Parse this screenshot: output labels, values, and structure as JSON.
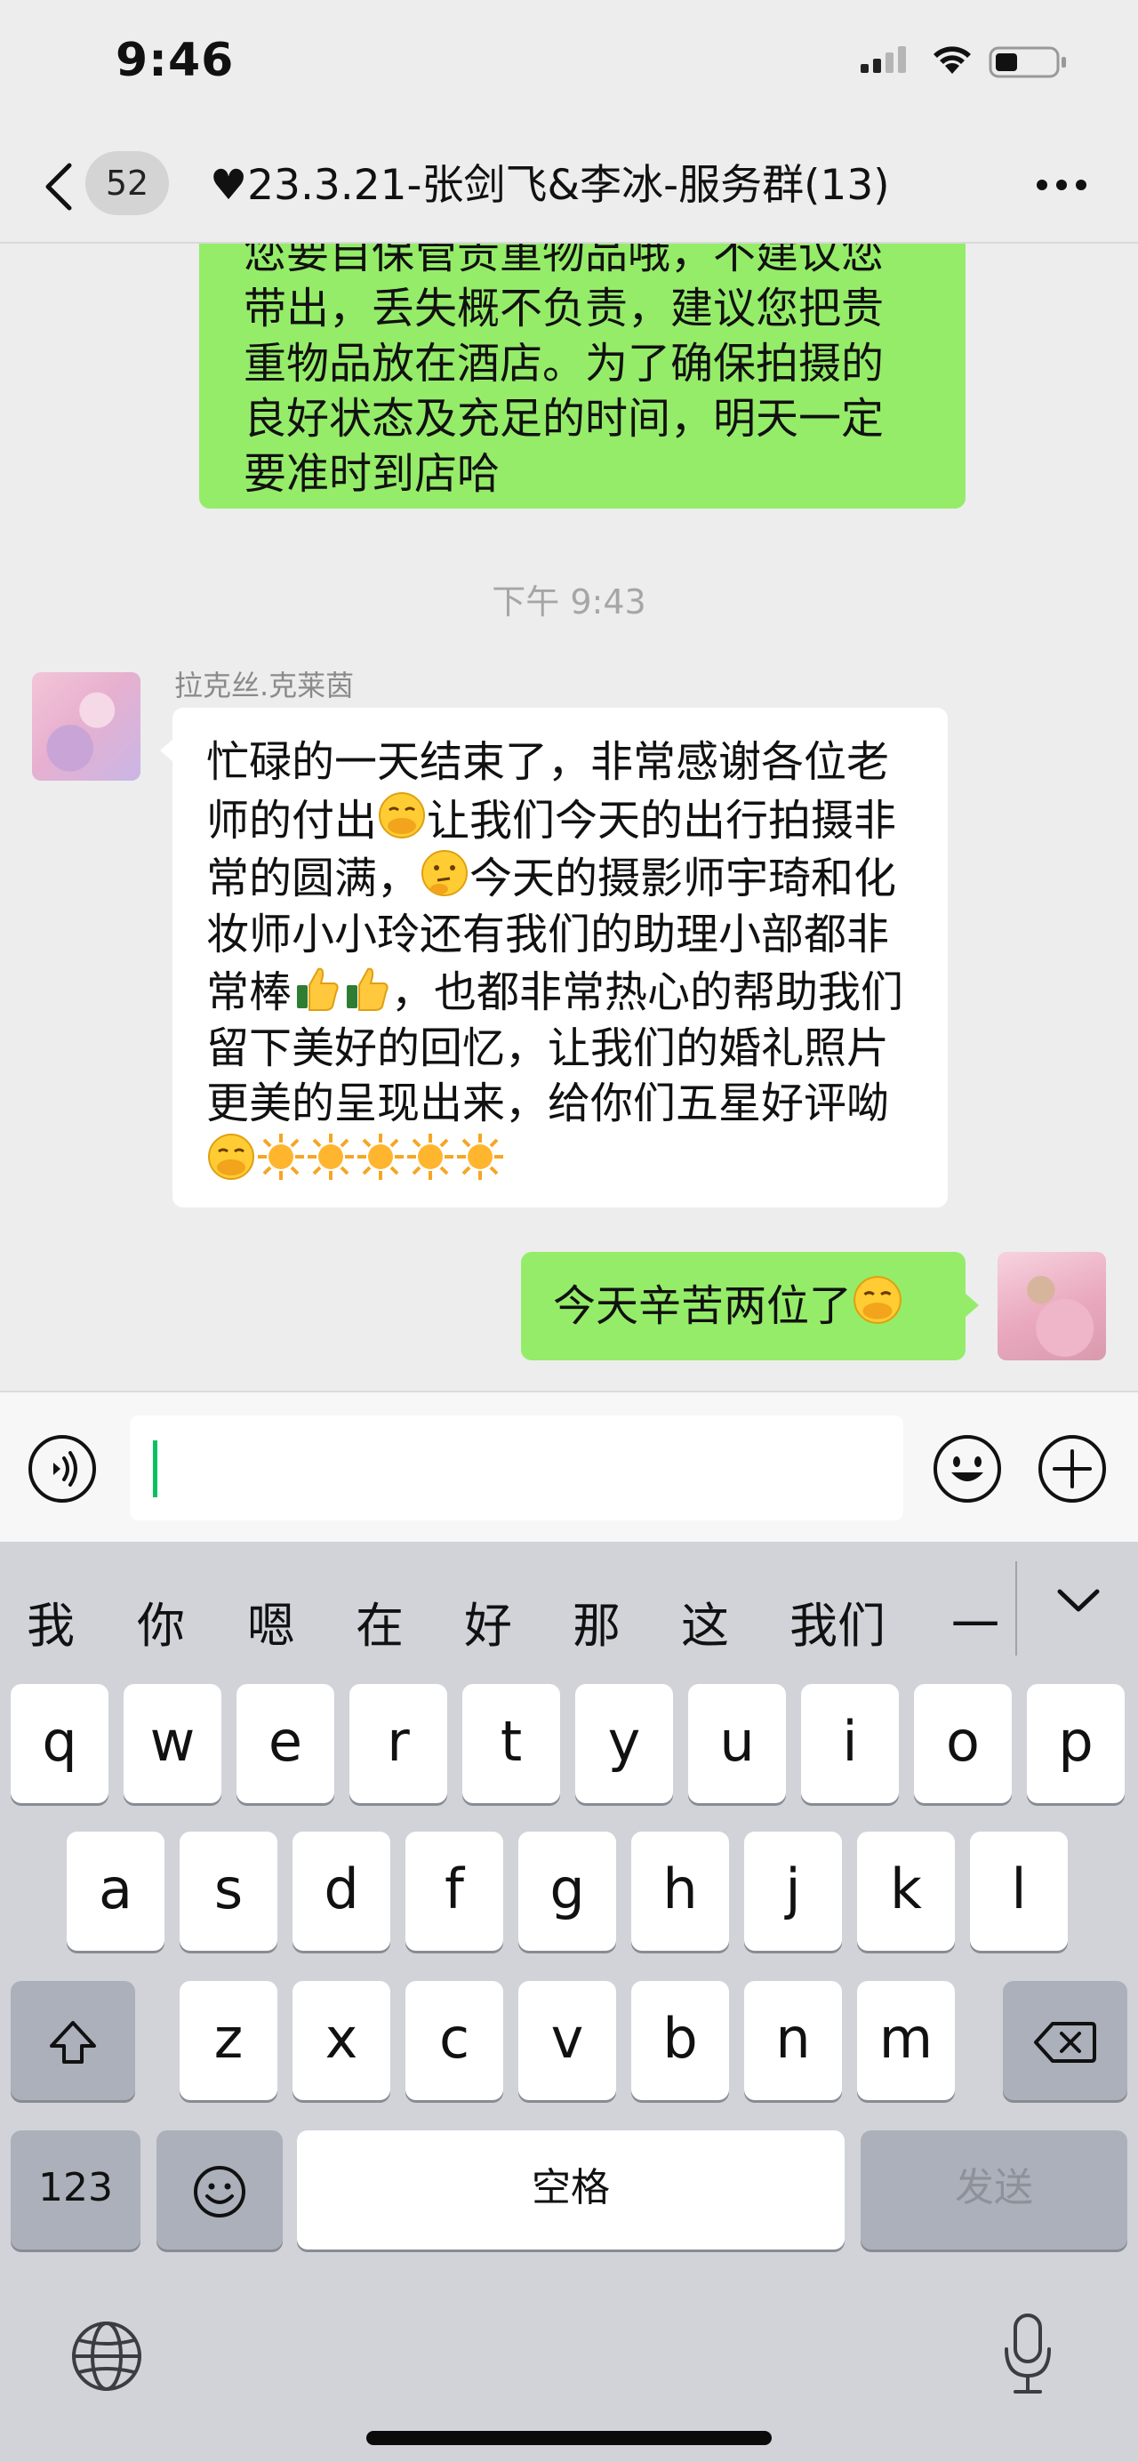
{
  "status_bar": {
    "time": "9:46",
    "icons": [
      "signal-icon",
      "wifi-icon",
      "battery-icon"
    ]
  },
  "nav": {
    "back_icon": "chevron-left-icon",
    "unread_count": "52",
    "title": "♥23.3.21-张剑飞&李冰-服务群(13)",
    "more_icon": "more-dots-icon"
  },
  "messages": {
    "top_message": {
      "lines": [
        "您要自保管贵重物品哦，不建议您",
        "带出，丢失概不负责，建议您把贵",
        "重物品放在酒店。为了确保拍摄的",
        "良好状态及充足的时间，明天一定",
        "要准时到店哈"
      ]
    },
    "timestamp": "下午 9:43",
    "incoming": {
      "sender": "拉克丝.克莱茵",
      "text_1": "忙碌的一天结束了，非常感谢各位老师的付出",
      "text_2": "让我们今天的出行拍摄非常的圆满，",
      "text_3": "今天的摄影师宇琦和化妆师小小玲还有我们的助理小部都非常棒",
      "text_4": "，也都非常热心的帮助我们留下美好的回忆，让我们的婚礼照片更美的呈现出来，给你们五星好评呦",
      "emojis": [
        "hand-over-mouth-emoji",
        "thinking-emoji",
        "thumbs-up-emoji",
        "sun-emoji"
      ]
    },
    "outgoing": {
      "text": "今天辛苦两位了",
      "emoji": "hand-over-mouth-emoji"
    }
  },
  "input_bar": {
    "value": "",
    "icons": [
      "voice-icon",
      "emoji-icon",
      "plus-icon"
    ]
  },
  "keyboard": {
    "suggestions": [
      "我",
      "你",
      "嗯",
      "在",
      "好",
      "那",
      "这",
      "我们",
      "一"
    ],
    "row1": [
      "q",
      "w",
      "e",
      "r",
      "t",
      "y",
      "u",
      "i",
      "o",
      "p"
    ],
    "row2": [
      "a",
      "s",
      "d",
      "f",
      "g",
      "h",
      "j",
      "k",
      "l"
    ],
    "row3": [
      "z",
      "x",
      "c",
      "v",
      "b",
      "n",
      "m"
    ],
    "numbers_label": "123",
    "space_label": "空格",
    "send_label": "发送",
    "colors": {
      "background": "#d1d3d9",
      "key": "#ffffff",
      "dark_key": "#abb0ba",
      "send_text": "#8e9199"
    }
  },
  "colors": {
    "chat_background": "#ededed",
    "my_bubble": "#95ec69",
    "their_bubble": "#ffffff",
    "cursor": "#07c160"
  }
}
